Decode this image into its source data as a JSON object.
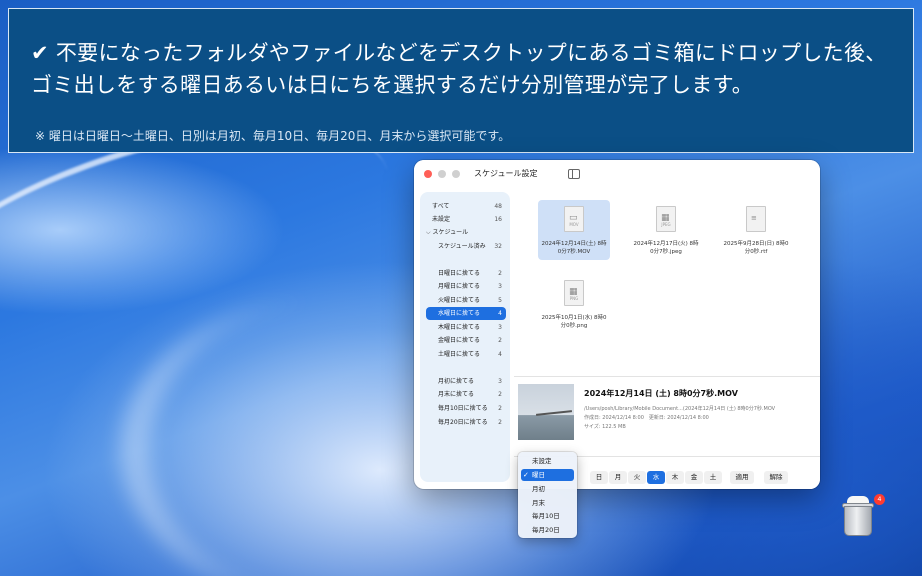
{
  "banner": {
    "headline": "✔ 不要になったフォルダやファイルなどをデスクトップにあるゴミ箱にドロップした後、ゴミ出しをする曜日あるいは日にちを選択するだけ分別管理が完了します。",
    "note": "※ 曜日は日曜日〜土曜日、日別は月初、毎月10日、毎月20日、月末から選択可能です。"
  },
  "window": {
    "title": "スケジュール設定"
  },
  "sidebar": {
    "items": [
      {
        "label": "すべて",
        "count": "48"
      },
      {
        "label": "未設定",
        "count": "16"
      },
      {
        "label": "スケジュール",
        "count": ""
      },
      {
        "label": "スケジュール済み",
        "count": "32"
      },
      {
        "label": "日曜日に捨てる",
        "count": "2"
      },
      {
        "label": "月曜日に捨てる",
        "count": "3"
      },
      {
        "label": "火曜日に捨てる",
        "count": "5"
      },
      {
        "label": "水曜日に捨てる",
        "count": "4"
      },
      {
        "label": "木曜日に捨てる",
        "count": "3"
      },
      {
        "label": "金曜日に捨てる",
        "count": "2"
      },
      {
        "label": "土曜日に捨てる",
        "count": "4"
      },
      {
        "label": "月初に捨てる",
        "count": "3"
      },
      {
        "label": "月末に捨てる",
        "count": "2"
      },
      {
        "label": "毎月10日に捨てる",
        "count": "2"
      },
      {
        "label": "毎月20日に捨てる",
        "count": "2"
      }
    ]
  },
  "files": [
    {
      "name": "2024年12月14日(土) 8時0分7秒.MOV",
      "ext": "MOV",
      "icon": "video-icon"
    },
    {
      "name": "2024年12月17日(火) 8時0分7秒.jpeg",
      "ext": "JPEG",
      "icon": "image-icon"
    },
    {
      "name": "2025年9月28日(日) 8時0分0秒.rtf",
      "ext": "",
      "icon": "document-icon"
    },
    {
      "name": "2025年10月1日(水) 8時0分0秒.png",
      "ext": "PNG",
      "icon": "image-icon"
    }
  ],
  "preview": {
    "title": "2024年12月14日 (土) 8時0分7秒.MOV",
    "path": "/Users/posh/Library/Mobile Document...(2024年12月14日 (土) 8時0分7秒.MOV",
    "dates": "作成日: 2024/12/14 8:00　更新日: 2024/12/14 8:00",
    "size": "サイズ: 122.5 MB"
  },
  "weekdays": [
    "日",
    "月",
    "火",
    "水",
    "木",
    "金",
    "土"
  ],
  "selected_weekday": "水",
  "buttons": {
    "apply": "適用",
    "cancel": "解除"
  },
  "menu": {
    "items": [
      "未設定",
      "曜日",
      "月初",
      "月末",
      "毎月10日",
      "毎月20日"
    ],
    "selected": "曜日"
  },
  "trash": {
    "badge": "4"
  },
  "colors": {
    "accent": "#1e6fe0",
    "banner": "#0b4f86",
    "badge": "#ff3b30"
  }
}
